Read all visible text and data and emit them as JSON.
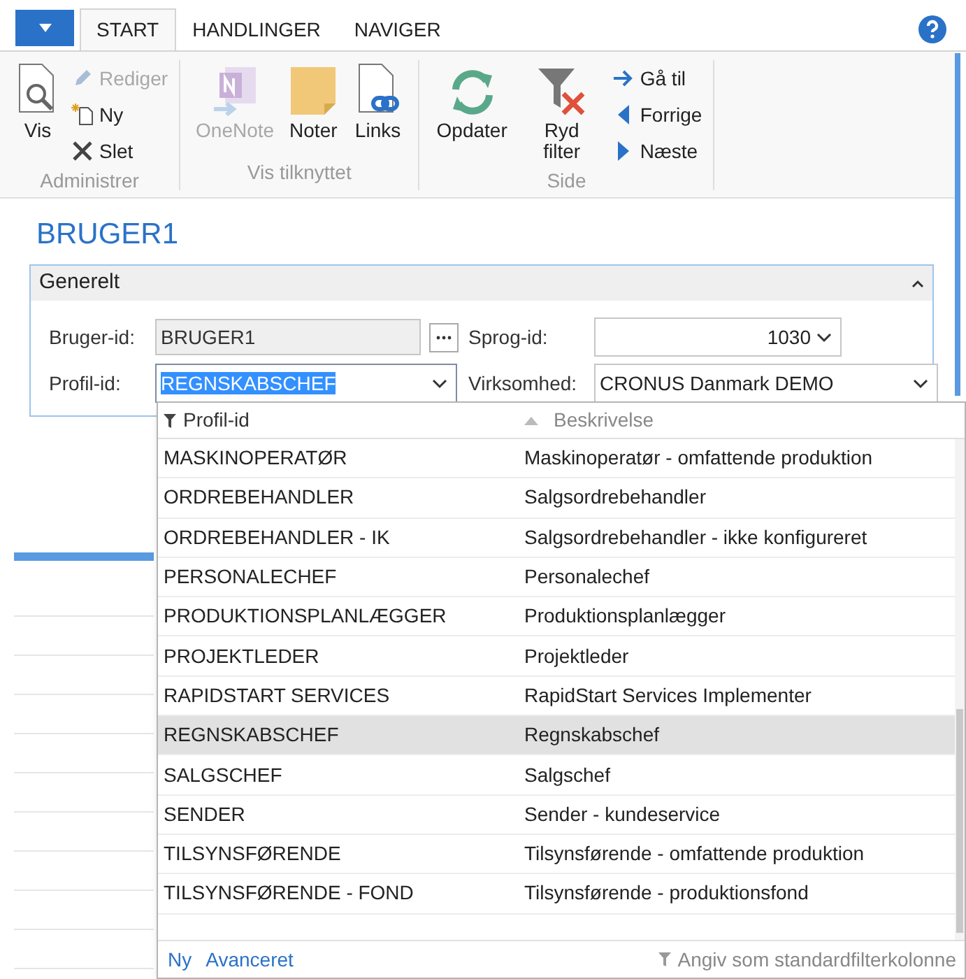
{
  "tabs": [
    {
      "label": "START",
      "selected": true
    },
    {
      "label": "HANDLINGER",
      "selected": false
    },
    {
      "label": "NAVIGER",
      "selected": false
    }
  ],
  "ribbon_groups": [
    {
      "label": "Administrer",
      "actions": [
        {
          "label": "Vis",
          "kind": "large",
          "disabled": false
        },
        {
          "label": "Rediger",
          "kind": "small",
          "disabled": true
        },
        {
          "label": "Ny",
          "kind": "small",
          "disabled": false
        },
        {
          "label": "Slet",
          "kind": "small",
          "disabled": false
        }
      ]
    },
    {
      "label": "Vis tilknyttet",
      "actions": [
        {
          "label": "OneNote",
          "kind": "large",
          "disabled": true
        },
        {
          "label": "Noter",
          "kind": "large",
          "disabled": false
        },
        {
          "label": "Links",
          "kind": "large",
          "disabled": false
        }
      ]
    },
    {
      "label": "Side",
      "actions": [
        {
          "label": "Opdater",
          "kind": "large",
          "disabled": false
        },
        {
          "label": "Ryd filter",
          "kind": "large",
          "disabled": false
        },
        {
          "label": "Gå til",
          "kind": "small",
          "disabled": false
        },
        {
          "label": "Forrige",
          "kind": "small",
          "disabled": false
        },
        {
          "label": "Næste",
          "kind": "small",
          "disabled": false
        }
      ]
    }
  ],
  "page_title": "BRUGER1",
  "section": {
    "title": "Generelt",
    "expanded": true,
    "fields": [
      {
        "label": "Bruger-id:",
        "value": "BRUGER1",
        "kind": "assist"
      },
      {
        "label": "Sprog-id:",
        "value": "1030",
        "kind": "number"
      },
      {
        "label": "Profil-id:",
        "value": "REGNSKABSCHEF",
        "kind": "dropdown"
      },
      {
        "label": "Virksomhed:",
        "value": "CRONUS Danmark DEMO",
        "kind": "dropdown"
      }
    ]
  },
  "lookup": {
    "columns": [
      {
        "label": "Profil-id",
        "kind": "filter"
      },
      {
        "label": "Beskrivelse",
        "kind": "sort"
      }
    ],
    "rows": [
      {
        "cells": [
          "MASKINOPERATØR",
          "Maskinoperatør - omfattende produktion"
        ],
        "selected": false
      },
      {
        "cells": [
          "ORDREBEHANDLER",
          "Salgsordrebehandler"
        ],
        "selected": false
      },
      {
        "cells": [
          "ORDREBEHANDLER - IK",
          "Salgsordrebehandler - ikke konfigureret"
        ],
        "selected": false
      },
      {
        "cells": [
          "PERSONALECHEF",
          "Personalechef"
        ],
        "selected": false
      },
      {
        "cells": [
          "PRODUKTIONSPLANLÆGGER",
          "Produktionsplanlægger"
        ],
        "selected": false
      },
      {
        "cells": [
          "PROJEKTLEDER",
          "Projektleder"
        ],
        "selected": false
      },
      {
        "cells": [
          "RAPIDSTART SERVICES",
          "RapidStart Services Implementer"
        ],
        "selected": false
      },
      {
        "cells": [
          "REGNSKABSCHEF",
          "Regnskabschef"
        ],
        "selected": true
      },
      {
        "cells": [
          "SALGSCHEF",
          "Salgschef"
        ],
        "selected": false
      },
      {
        "cells": [
          "SENDER",
          "Sender - kundeservice"
        ],
        "selected": false
      },
      {
        "cells": [
          "TILSYNSFØRENDE",
          "Tilsynsførende - omfattende produktion"
        ],
        "selected": false
      },
      {
        "cells": [
          "TILSYNSFØRENDE - FOND",
          "Tilsynsførende - produktionsfond"
        ],
        "selected": false
      }
    ],
    "links": [
      "Ny",
      "Avanceret"
    ],
    "filter_hint": "Angiv som standardfilterkolonne"
  }
}
